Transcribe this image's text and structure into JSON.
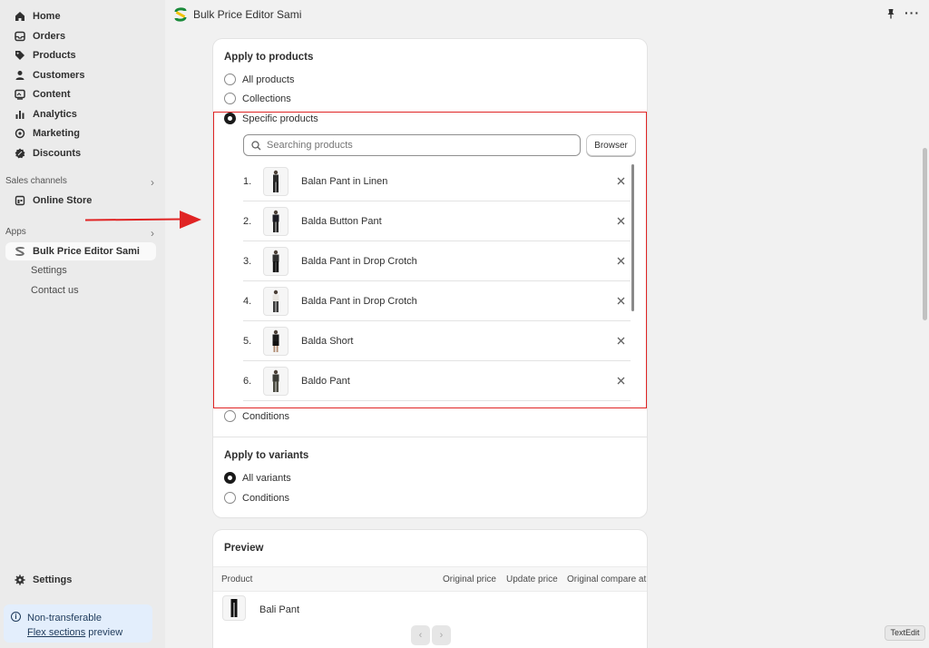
{
  "sidebar": {
    "nav": [
      {
        "label": "Home",
        "icon": "home-icon"
      },
      {
        "label": "Orders",
        "icon": "inbox-icon"
      },
      {
        "label": "Products",
        "icon": "tag-icon"
      },
      {
        "label": "Customers",
        "icon": "person-icon"
      },
      {
        "label": "Content",
        "icon": "image-icon"
      },
      {
        "label": "Analytics",
        "icon": "bar-chart-icon"
      },
      {
        "label": "Marketing",
        "icon": "target-icon"
      },
      {
        "label": "Discounts",
        "icon": "discount-icon"
      }
    ],
    "sales_channels_label": "Sales channels",
    "online_store": "Online Store",
    "apps_label": "Apps",
    "app_name": "Bulk Price Editor Sami",
    "app_sub": [
      "Settings",
      "Contact us"
    ],
    "settings": "Settings",
    "notice_line1": "Non-transferable",
    "notice_link": "Flex sections",
    "notice_rest": " preview"
  },
  "topbar": {
    "title": "Bulk Price Editor Sami"
  },
  "apply_products": {
    "title": "Apply to products",
    "options": [
      "All products",
      "Collections",
      "Specific products",
      "Conditions"
    ],
    "selected": "Specific products",
    "search_placeholder": "Searching products",
    "browse_label": "Browser",
    "products": [
      {
        "num": "1.",
        "name": "Balan Pant in Linen"
      },
      {
        "num": "2.",
        "name": "Balda Button Pant"
      },
      {
        "num": "3.",
        "name": "Balda Pant in Drop Crotch"
      },
      {
        "num": "4.",
        "name": "Balda Pant in Drop Crotch"
      },
      {
        "num": "5.",
        "name": "Balda Short"
      },
      {
        "num": "6.",
        "name": "Baldo Pant"
      }
    ]
  },
  "apply_variants": {
    "title": "Apply to variants",
    "options": [
      "All variants",
      "Conditions"
    ],
    "selected": "All variants"
  },
  "preview": {
    "title": "Preview",
    "columns": [
      "Product",
      "Original price",
      "Update price",
      "Original compare at"
    ],
    "rows": [
      {
        "product": "Bali Pant"
      }
    ]
  },
  "textedit_label": "TextEdit",
  "colors": {
    "highlight": "#e02424",
    "arrow": "#e02424",
    "notice_bg": "#e3eefc"
  }
}
